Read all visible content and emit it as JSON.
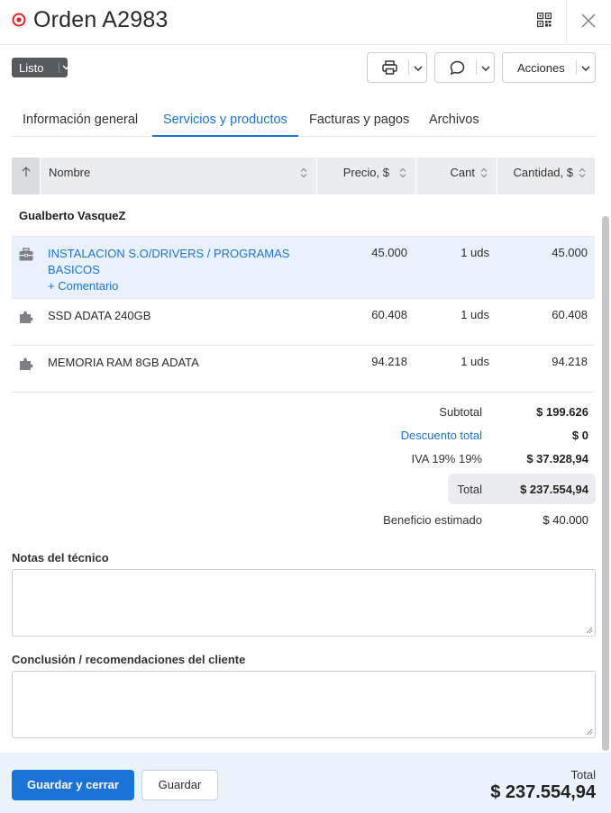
{
  "header": {
    "title": "Orden A2983",
    "icons": {
      "status": "target-icon",
      "qr": "qr-code-icon",
      "close": "close-icon"
    }
  },
  "toolbar": {
    "status": "Listo",
    "print_icon": "printer-icon",
    "comment_icon": "speech-bubble-icon",
    "actions_label": "Acciones"
  },
  "tabs": [
    {
      "label": "Información general",
      "active": false
    },
    {
      "label": "Servicios y productos",
      "active": true
    },
    {
      "label": "Facturas y pagos",
      "active": false
    },
    {
      "label": "Archivos",
      "active": false
    }
  ],
  "table": {
    "columns": [
      "Nombre",
      "Precio, $",
      "Cant",
      "Cantidad, $"
    ],
    "customer": "Gualberto VasqueZ",
    "rows": [
      {
        "icon": "briefcase-icon",
        "name": "INSTALACION S.O/DRIVERS / PROGRAMAS BASICOS",
        "type": "service",
        "comment_label": "+ Comentario",
        "price": "45.000",
        "qty": "1 uds",
        "amount": "45.000"
      },
      {
        "icon": "puzzle-piece-icon",
        "name": "SSD ADATA 240GB",
        "type": "product",
        "price": "60.408",
        "qty": "1 uds",
        "amount": "60.408"
      },
      {
        "icon": "puzzle-piece-icon",
        "name": "MEMORIA RAM 8GB ADATA",
        "type": "product",
        "price": "94.218",
        "qty": "1 uds",
        "amount": "94.218"
      }
    ]
  },
  "summary": {
    "subtotal_label": "Subtotal",
    "subtotal_value": "$ 199.626",
    "discount_label": "Descuento total",
    "discount_value": "$ 0",
    "tax_label": "IVA 19% 19%",
    "tax_value": "$ 37.928,94",
    "total_label": "Total",
    "total_value": "$ 237.554,94",
    "profit_label": "Beneficio estimado",
    "profit_value": "$ 40.000"
  },
  "notes": {
    "tech_label": "Notas del técnico",
    "tech_value": "",
    "client_label": "Conclusión / recomendaciones del cliente",
    "client_value": ""
  },
  "footer": {
    "save_close_label": "Guardar y cerrar",
    "save_label": "Guardar",
    "total_label": "Total",
    "total_value": "$ 237.554,94"
  },
  "colors": {
    "accent": "#1b73d8",
    "status_badge": "#555a5f",
    "status_icon": "#e02424",
    "row_highlight": "#e9f2fc",
    "footer_bg": "#eaf2fb"
  }
}
